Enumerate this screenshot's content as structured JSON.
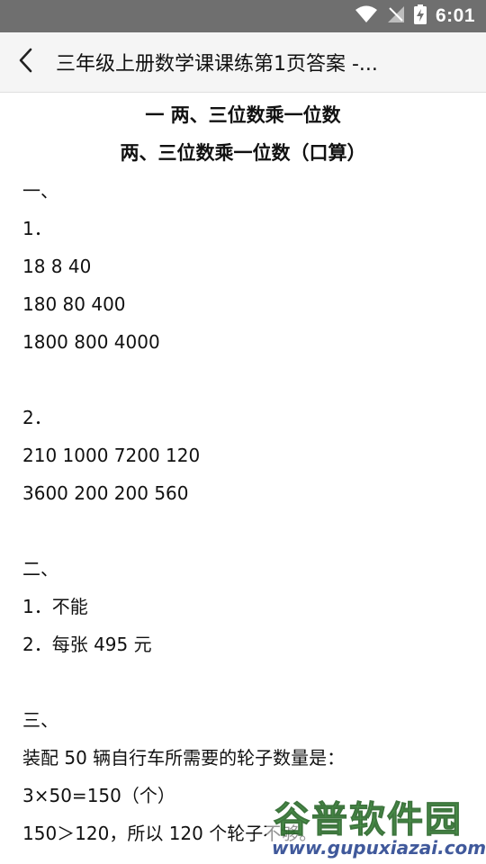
{
  "status_bar": {
    "time": "6:01",
    "icons": [
      "wifi-icon",
      "no-signal-icon",
      "battery-charging-icon"
    ]
  },
  "app_bar": {
    "back_icon": "chevron-left-icon",
    "title": "三年级上册数学课课练第1页答案 -..."
  },
  "article": {
    "heading_1": "一 两、三位数乘一位数",
    "heading_2": "两、三位数乘一位数（口算）",
    "lines": [
      "一、",
      "1．",
      "18 8 40",
      "180 80 400",
      "1800 800 4000",
      "",
      "2．",
      "210 1000 7200 120",
      "3600 200 200 560",
      "",
      "二、",
      "1．不能",
      "2．每张 495 元",
      "",
      "三、",
      "装配 50 辆自行车所需要的轮子数量是：",
      "3×50=150（个）",
      " 150＞120，所以 120 个轮子不够。"
    ]
  },
  "watermark": {
    "logo_text": "谷普软件园",
    "url": "www.gupuxiazai.com"
  }
}
